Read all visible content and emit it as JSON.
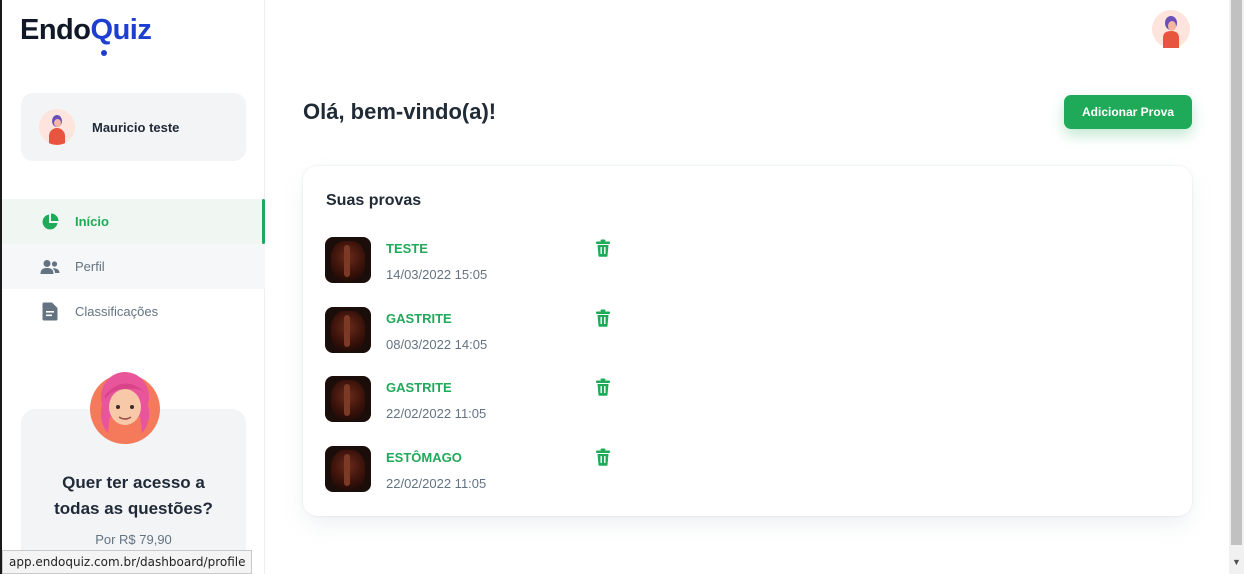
{
  "brand": {
    "logo_part1": "Endo",
    "logo_q": "Q",
    "logo_part2": "uiz"
  },
  "sidebar": {
    "user_name": "Mauricio teste",
    "items": [
      {
        "label": "Início",
        "icon": "pie-chart-icon",
        "active": true
      },
      {
        "label": "Perfil",
        "icon": "users-icon",
        "active": false
      },
      {
        "label": "Classificações",
        "icon": "document-icon",
        "active": false
      }
    ],
    "promo": {
      "title_line1": "Quer ter acesso a",
      "title_line2": "todas as questões?",
      "price": "Por R$ 79,90"
    }
  },
  "status_bar": {
    "url": "app.endoquiz.com.br/dashboard/profile"
  },
  "main": {
    "greeting": "Olá, bem-vindo(a)!",
    "add_button": "Adicionar Prova",
    "card_title": "Suas provas",
    "exams": [
      {
        "name": "TESTE",
        "date": "14/03/2022 15:05"
      },
      {
        "name": "GASTRITE",
        "date": "08/03/2022 14:05"
      },
      {
        "name": "GASTRITE",
        "date": "22/02/2022 11:05"
      },
      {
        "name": "ESTÔMAGO",
        "date": "22/02/2022 11:05"
      }
    ]
  },
  "colors": {
    "accent": "#1faa59",
    "brand_blue": "#1d3fcf",
    "text_dark": "#212b36",
    "text_muted": "#637381"
  }
}
